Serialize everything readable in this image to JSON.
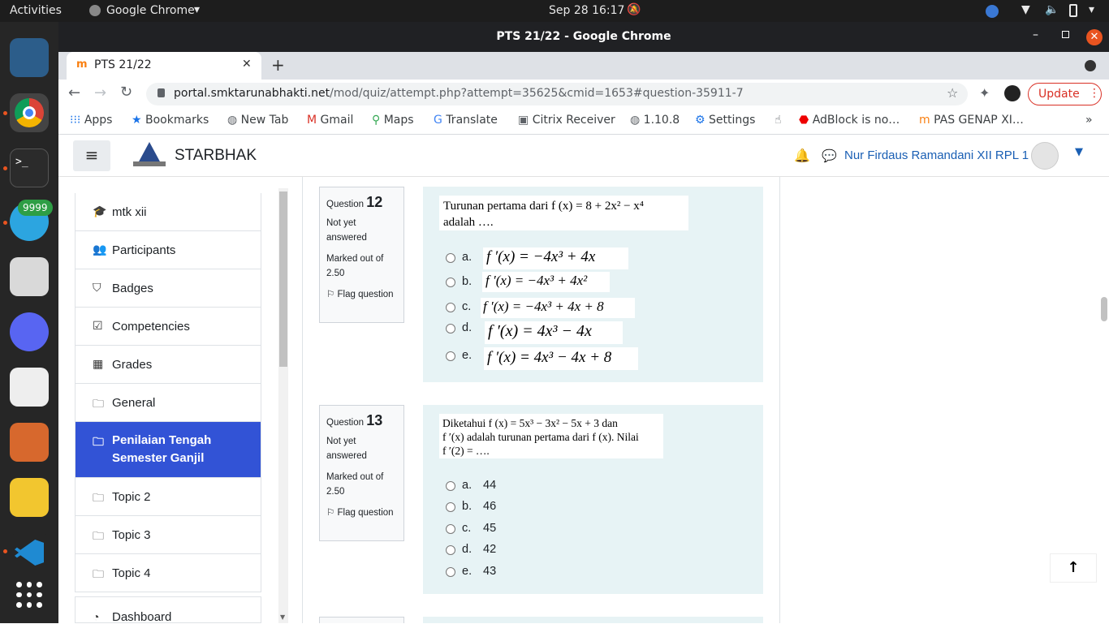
{
  "system": {
    "activities": "Activities",
    "app_name": "Google Chrome",
    "clock": "Sep 28  16:17"
  },
  "dock": {
    "telegram_badge": "9999"
  },
  "browser": {
    "window_title": "PTS 21/22 - Google Chrome",
    "tab_title": "PTS 21/22",
    "url_domain": "portal.smktarunabhakti.net",
    "url_path": "/mod/quiz/attempt.php?attempt=35625&cmid=1653#question-35911-7",
    "update_label": "Update",
    "bookmarks": [
      "Apps",
      "Bookmarks",
      "New Tab",
      "Gmail",
      "Maps",
      "Translate",
      "Citrix Receiver",
      "1.10.8",
      "Settings",
      "",
      "AdBlock is no…",
      "PAS GENAP XI…"
    ]
  },
  "site": {
    "brand": "STARBHAK",
    "user_name": "Nur Firdaus Ramandani XII RPL 1"
  },
  "sidebar": {
    "items": [
      {
        "label": "mtk xii",
        "icon": "graduation-cap-icon"
      },
      {
        "label": "Participants",
        "icon": "users-icon"
      },
      {
        "label": "Badges",
        "icon": "shield-icon"
      },
      {
        "label": "Competencies",
        "icon": "check-square-icon"
      },
      {
        "label": "Grades",
        "icon": "table-icon"
      },
      {
        "label": "General",
        "icon": "folder-icon"
      },
      {
        "label": "Penilaian Tengah Semester Ganjil",
        "icon": "folder-icon",
        "active": true
      },
      {
        "label": "Topic 2",
        "icon": "folder-icon"
      },
      {
        "label": "Topic 3",
        "icon": "folder-icon"
      },
      {
        "label": "Topic 4",
        "icon": "folder-icon"
      },
      {
        "label": "Dashboard",
        "icon": "dashboard-icon"
      }
    ]
  },
  "questions": [
    {
      "label": "Question",
      "number": "12",
      "status": "Not yet answered",
      "marked": "Marked out of 2.50",
      "flag": "Flag question",
      "stem_line1": "Turunan pertama dari f (x) = 8 + 2x² − x⁴",
      "stem_line2": "adalah ….",
      "options": [
        {
          "letter": "a.",
          "value": "f ′(x) = −4x³ + 4x"
        },
        {
          "letter": "b.",
          "value": "f ′(x) = −4x³ + 4x²"
        },
        {
          "letter": "c.",
          "value": "f ′(x) = −4x³ + 4x + 8"
        },
        {
          "letter": "d.",
          "value": "f ′(x) = 4x³ − 4x"
        },
        {
          "letter": "e.",
          "value": "f ′(x) = 4x³ − 4x + 8"
        }
      ]
    },
    {
      "label": "Question",
      "number": "13",
      "status": "Not yet answered",
      "marked": "Marked out of 2.50",
      "flag": "Flag question",
      "stem_line1": "Diketahui f (x) = 5x³ − 3x² − 5x + 3 dan",
      "stem_line2": "f ′(x) adalah turunan pertama dari f (x). Nilai",
      "stem_line3": "f ′(2) = ….",
      "options": [
        {
          "letter": "a.",
          "value": "44"
        },
        {
          "letter": "b.",
          "value": "46"
        },
        {
          "letter": "c.",
          "value": "45"
        },
        {
          "letter": "d.",
          "value": "42"
        },
        {
          "letter": "e.",
          "value": "43"
        }
      ]
    }
  ]
}
